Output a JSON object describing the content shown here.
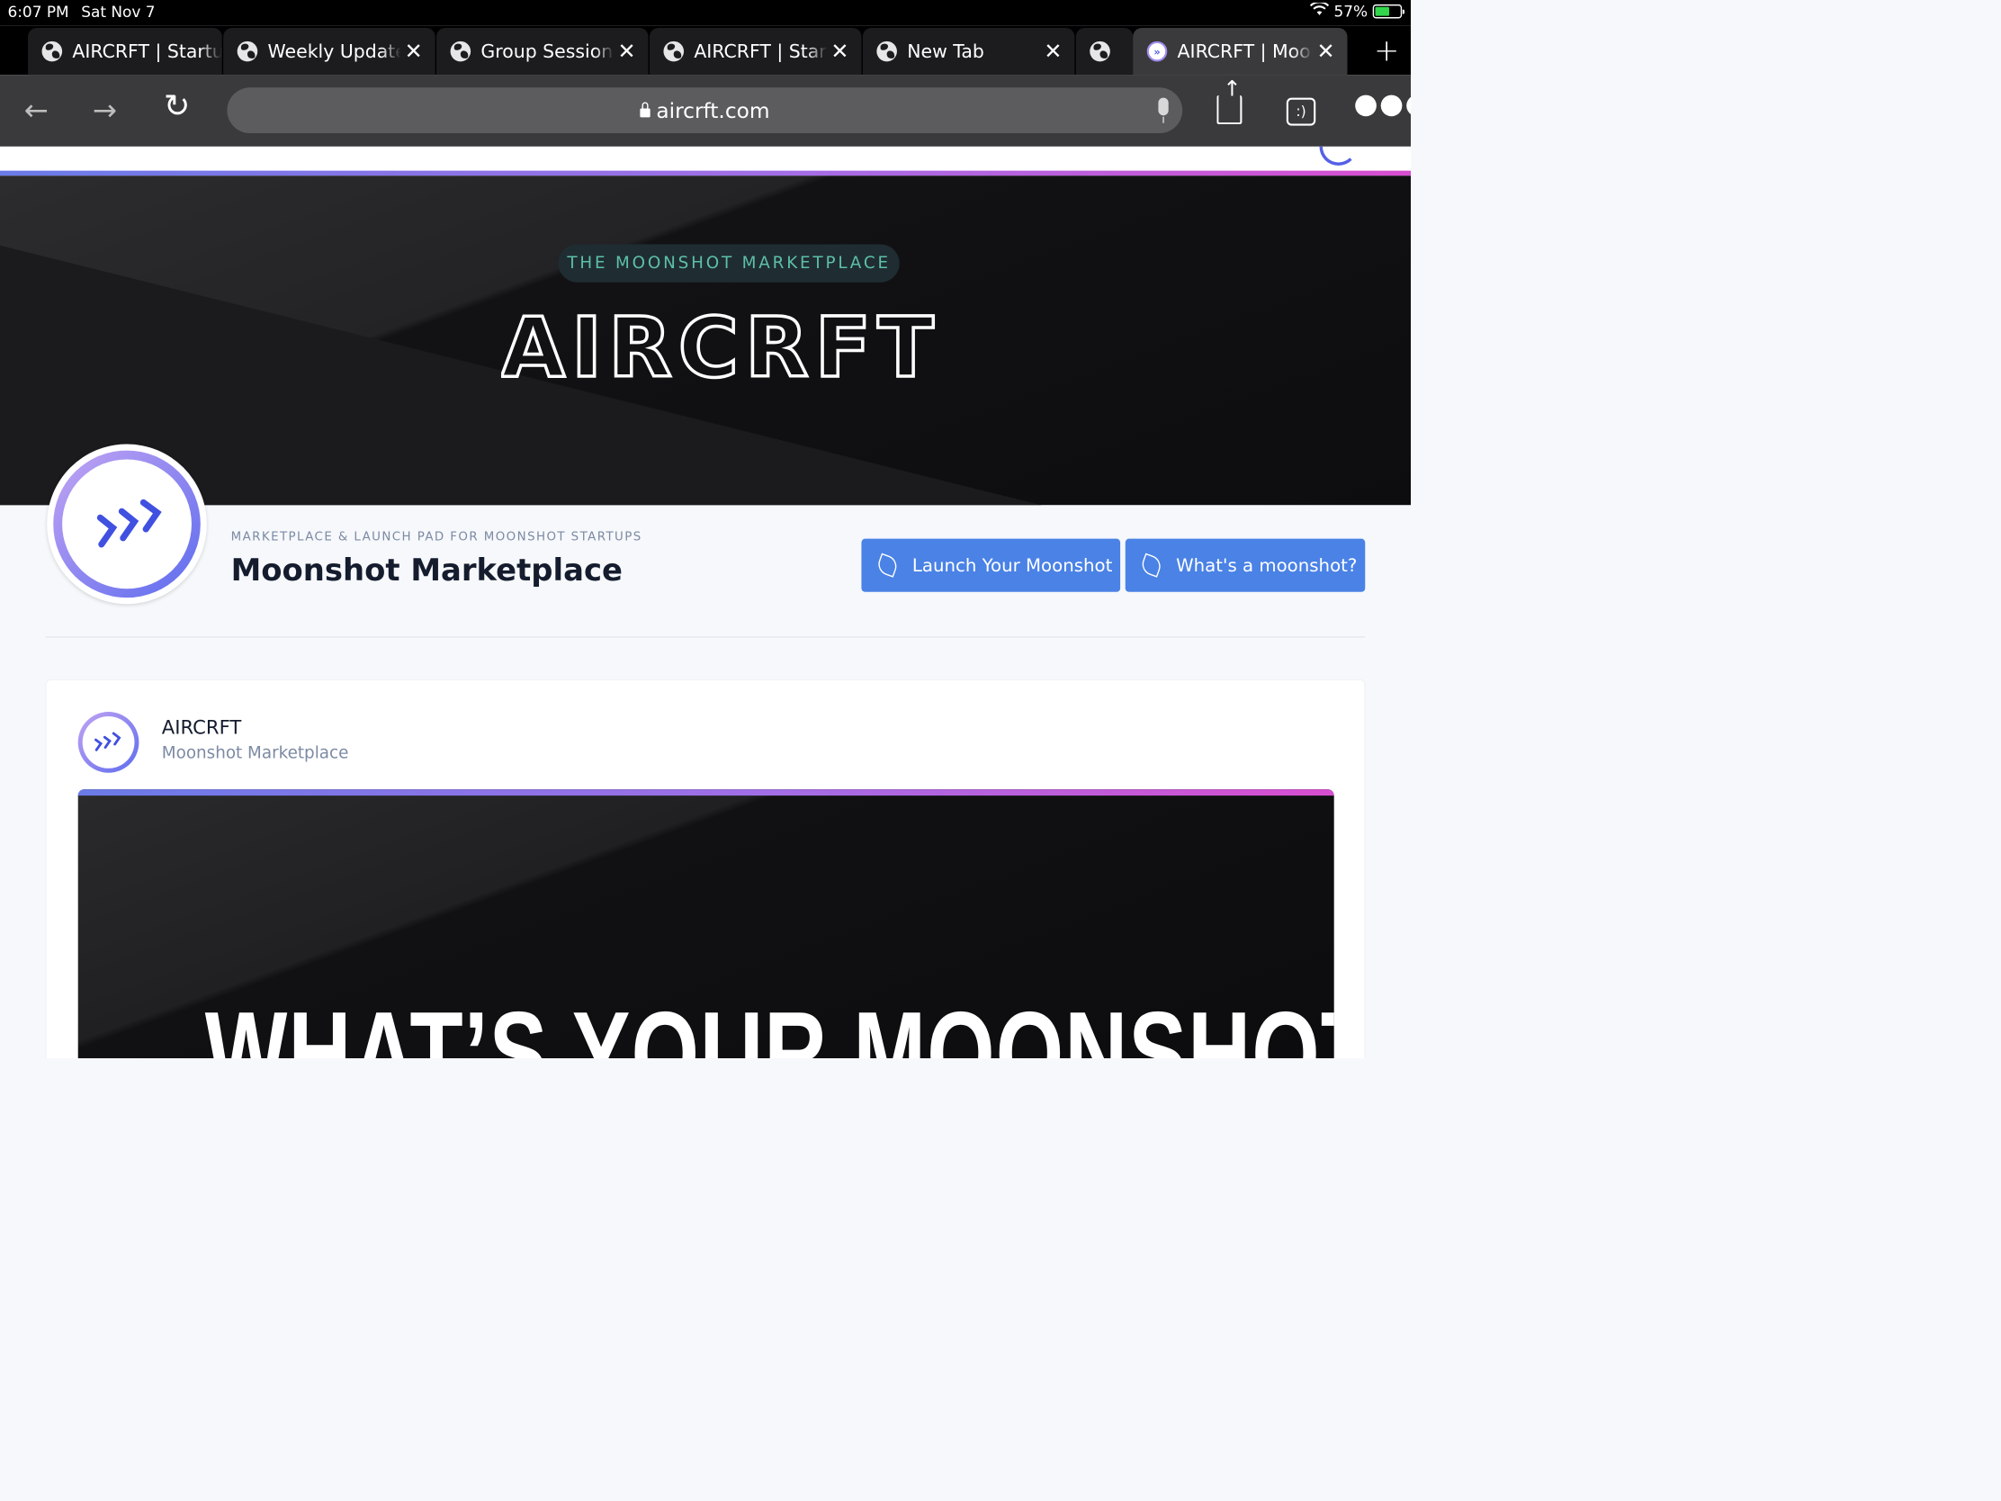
{
  "status": {
    "time": "6:07 PM",
    "date": "Sat Nov 7",
    "battery": "57%",
    "battery_level": 0.57
  },
  "tabs": [
    {
      "label": "AIRCRFT | Startup",
      "icon": "globe-icon"
    },
    {
      "label": "Weekly Update",
      "icon": "globe-icon"
    },
    {
      "label": "Group Sessions",
      "icon": "globe-icon"
    },
    {
      "label": "AIRCRFT | Startup",
      "icon": "globe-icon"
    },
    {
      "label": "New Tab",
      "icon": "globe-icon"
    },
    {
      "label": "AIRCRFT | Moonshot",
      "icon": "aircrft-favicon",
      "active": true
    }
  ],
  "toolbar": {
    "url": "aircrft.com",
    "tabs_button": ":)"
  },
  "hero": {
    "tagline": "THE MOONSHOT MARKETPLACE",
    "logo_text": "AIRCRFT"
  },
  "header": {
    "subtitle": "MARKETPLACE & LAUNCH PAD FOR MOONSHOT STARTUPS",
    "title": "Moonshot Marketplace",
    "buttons": {
      "launch": "Launch Your Moonshot",
      "whats": "What's a moonshot?"
    }
  },
  "post": {
    "author": "AIRCRFT",
    "subtitle": "Moonshot Marketplace",
    "image_text": "WHAT’S YOUR MOONSHOT?"
  },
  "colors": {
    "accent": "#4a82e6",
    "tagline": "#5dbfa9",
    "gradient_start": "#6a7be8",
    "gradient_end": "#d84ed0"
  }
}
